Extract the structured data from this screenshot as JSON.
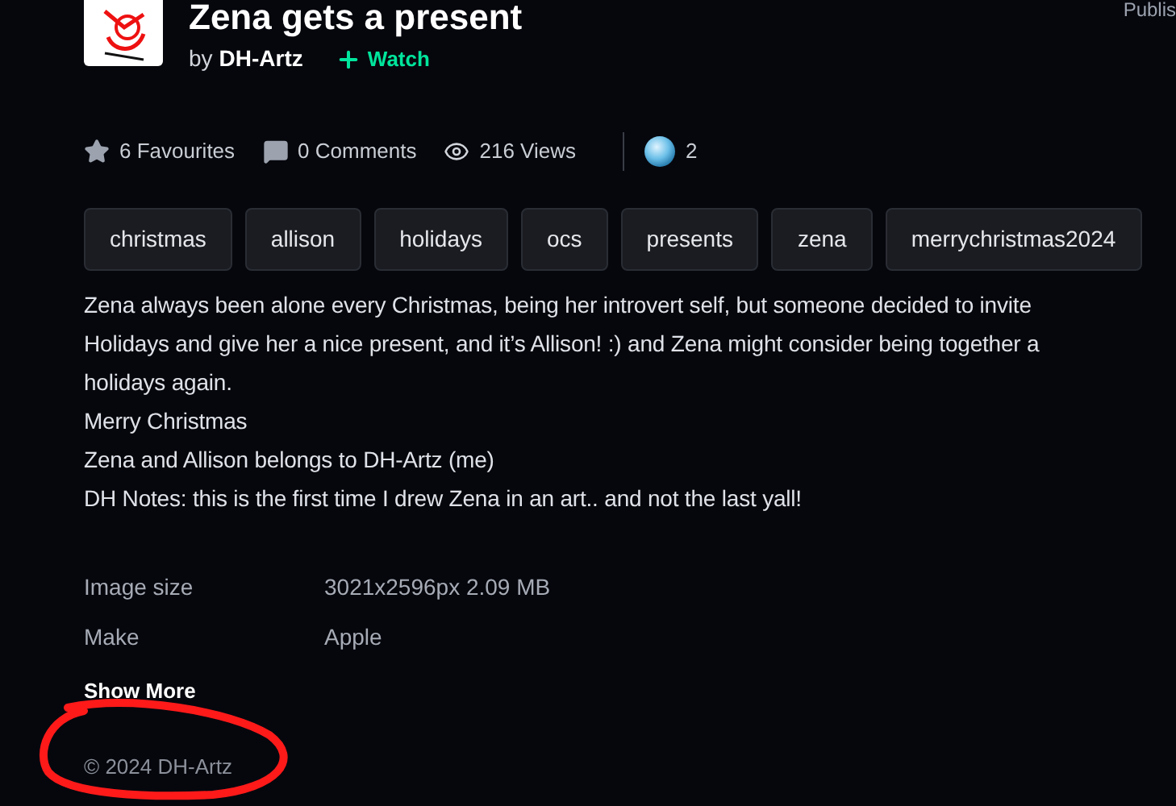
{
  "header": {
    "title": "Zena gets a present",
    "by": "by",
    "author": "DH-Artz",
    "watch": "Watch",
    "published": "Publis"
  },
  "stats": [
    {
      "kind": "favourites",
      "label": "6 Favourites"
    },
    {
      "kind": "comments",
      "label": "0 Comments"
    },
    {
      "kind": "views",
      "label": "216 Views"
    },
    {
      "kind": "gems",
      "label": "2"
    }
  ],
  "tags": [
    "christmas",
    "allison",
    "holidays",
    "ocs",
    "presents",
    "zena",
    "merrychristmas2024"
  ],
  "description": [
    "Zena always been alone every Christmas, being her introvert self, but someone decided to invite",
    "Holidays and give her a nice present, and it’s Allison! :) and Zena might consider being together a",
    "holidays again.",
    "Merry Christmas",
    "Zena and Allison belongs to DH-Artz (me)",
    "DH Notes: this is the first time I drew Zena in an art.. and not the last yall!"
  ],
  "details": [
    {
      "label": "Image size",
      "value": "3021x2596px 2.09 MB"
    },
    {
      "label": "Make",
      "value": "Apple"
    }
  ],
  "show_more": "Show More",
  "copyright": "© 2024 DH-Artz"
}
